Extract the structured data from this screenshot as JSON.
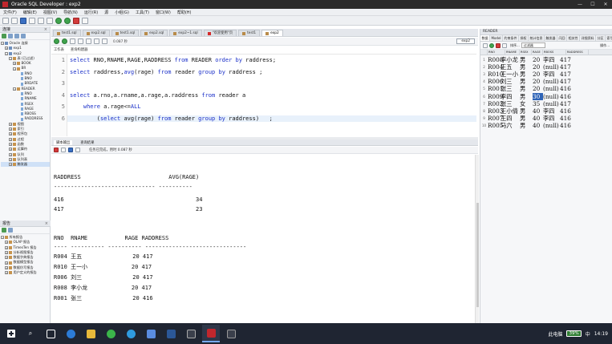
{
  "window": {
    "title": "Oracle SQL Developer : exp2",
    "controls": [
      "—",
      "☐",
      "✕"
    ]
  },
  "menu": [
    "文件(F)",
    "编辑(E)",
    "视图(V)",
    "导航(N)",
    "运行(R)",
    "源",
    "小组(G)",
    "工具(T)",
    "窗口(W)",
    "帮助(H)"
  ],
  "connections_panel": {
    "title": "连接",
    "close": "×",
    "tree": [
      {
        "label": "Oracle 连接",
        "level": 0,
        "toggle": "−",
        "icon": "db"
      },
      {
        "label": "exp1",
        "level": 1,
        "toggle": "+",
        "icon": "db"
      },
      {
        "label": "exp2",
        "level": 1,
        "toggle": "−",
        "icon": "db"
      },
      {
        "label": "表 (已过滤)",
        "level": 2,
        "toggle": "−",
        "icon": "folder"
      },
      {
        "label": "BOOK",
        "level": 3,
        "toggle": "+",
        "icon": "table"
      },
      {
        "label": "BR",
        "level": 3,
        "toggle": "−",
        "icon": "table"
      },
      {
        "label": "RNO",
        "level": 4,
        "toggle": "",
        "icon": "col"
      },
      {
        "label": "BNO",
        "level": 4,
        "toggle": "",
        "icon": "col"
      },
      {
        "label": "BRDATE",
        "level": 4,
        "toggle": "",
        "icon": "col"
      },
      {
        "label": "READER",
        "level": 3,
        "toggle": "−",
        "icon": "table"
      },
      {
        "label": "RNO",
        "level": 4,
        "toggle": "",
        "icon": "col"
      },
      {
        "label": "RNAME",
        "level": 4,
        "toggle": "",
        "icon": "col"
      },
      {
        "label": "RSEX",
        "level": 4,
        "toggle": "",
        "icon": "col"
      },
      {
        "label": "RAGE",
        "level": 4,
        "toggle": "",
        "icon": "col"
      },
      {
        "label": "RBOSS",
        "level": 4,
        "toggle": "",
        "icon": "col"
      },
      {
        "label": "RADDRESS",
        "level": 4,
        "toggle": "",
        "icon": "col"
      },
      {
        "label": "视图",
        "level": 2,
        "toggle": "+",
        "icon": "folder"
      },
      {
        "label": "索引",
        "level": 2,
        "toggle": "+",
        "icon": "folder"
      },
      {
        "label": "程序包",
        "level": 2,
        "toggle": "+",
        "icon": "folder"
      },
      {
        "label": "过程",
        "level": 2,
        "toggle": "+",
        "icon": "folder"
      },
      {
        "label": "函数",
        "level": 2,
        "toggle": "+",
        "icon": "folder"
      },
      {
        "label": "运算符",
        "level": 2,
        "toggle": "+",
        "icon": "folder"
      },
      {
        "label": "队列",
        "level": 2,
        "toggle": "+",
        "icon": "folder"
      },
      {
        "label": "队列表",
        "level": 2,
        "toggle": "+",
        "icon": "folder"
      },
      {
        "label": "触发器",
        "level": 2,
        "toggle": "+",
        "icon": "folder",
        "selected": true
      }
    ]
  },
  "reports_panel": {
    "title": "报告",
    "close": "×",
    "tree": [
      {
        "label": "所有报告",
        "level": 0,
        "toggle": "−"
      },
      {
        "label": "OLAP 报告",
        "level": 1,
        "toggle": "+"
      },
      {
        "label": "TimesTen 报告",
        "level": 1,
        "toggle": "+"
      },
      {
        "label": "分析视图报告",
        "level": 1,
        "toggle": "+"
      },
      {
        "label": "数据字典报告",
        "level": 1,
        "toggle": "+"
      },
      {
        "label": "数据模型报告",
        "level": 1,
        "toggle": "+"
      },
      {
        "label": "数据仿写报告",
        "level": 1,
        "toggle": "+"
      },
      {
        "label": "用户定义的报告",
        "level": 1,
        "toggle": "+"
      }
    ]
  },
  "editor_tabs": [
    {
      "label": "test1.sql",
      "alert": false,
      "active": false
    },
    {
      "label": "exp2.sql",
      "alert": false,
      "active": false
    },
    {
      "label": "test1.sql",
      "alert": false,
      "active": false
    },
    {
      "label": "exp2.sql",
      "alert": false,
      "active": false
    },
    {
      "label": "exp2~1.sql",
      "alert": false,
      "active": false
    },
    {
      "label": "\"欢迎使用\"页",
      "alert": true,
      "active": false
    },
    {
      "label": "test1",
      "alert": false,
      "active": false
    },
    {
      "label": "exp2",
      "alert": false,
      "active": true
    }
  ],
  "editor_toolbar": {
    "time": "0.087 秒",
    "connection": "exp2"
  },
  "editor_subtabs": [
    "工作表",
    "查询构建器"
  ],
  "code_lines": [
    {
      "n": "1",
      "html": "<span class='kw'>select</span> RNO,RNAME,RAGE,RADDRESS <span class='kw'>from</span> READER <span class='kw'>order by</span> raddress;"
    },
    {
      "n": "2",
      "html": "<span class='kw'>select</span> raddress,<span class='kw'>avg</span>(rage) <span class='kw'>from</span> reader <span class='kw'>group by</span> raddress ;"
    },
    {
      "n": "3",
      "html": ""
    },
    {
      "n": "4",
      "html": "<span class='kw'>select</span> a.rno,a.rname,a.rage,a.raddress <span class='kw'>from</span> reader a"
    },
    {
      "n": "5",
      "html": "    <span class='kw'>where</span> a.rage&lt;=<span class='kw'>ALL</span>"
    },
    {
      "n": "6",
      "html": "        (<span class='kw'>select</span> avg(rage) <span class='kw'>from</span> reader <span class='kw'>group by</span> raddress)   ;"
    }
  ],
  "output_tabs": [
    "脚本输出",
    "查询结果"
  ],
  "output_status": "任务已完成，用时 0.087 秒",
  "output_lines": [
    "RADDRESS                          AVG(RAGE)",
    "------------------------------ ----------",
    "416                                       34",
    "417                                       23",
    "",
    "",
    "RNO  RNAME           RAGE RADDRESS",
    "---- ---------- ---------- ------------------------------",
    "R004 王五               20 417",
    "R010 王一小             20 417",
    "R006 刘三               20 417",
    "R008 李小龙             20 417",
    "R001 张三               20 416"
  ],
  "reader_panel": {
    "title": "READER",
    "tabs": [
      "数据",
      "Model",
      "约束条件",
      "授权",
      "统计信息",
      "触发器",
      "闪回",
      "相关性",
      "详细资料",
      "分区",
      "索引",
      "SQL"
    ],
    "filter_label": "过滤器",
    "sort_label": "排序...",
    "actions_label": "操作...",
    "columns": [
      "RNO",
      "RNAME",
      "RSEX",
      "RAGE",
      "RBOSS",
      "RADDRESS"
    ],
    "rows": [
      [
        "1",
        "R008",
        "李小龙",
        "男",
        "20",
        "李四",
        "417"
      ],
      [
        "2",
        "R004",
        "王五",
        "男",
        "20",
        "(null)",
        "417"
      ],
      [
        "3",
        "R010",
        "王一小",
        "男",
        "20",
        "李四",
        "417"
      ],
      [
        "4",
        "R006",
        "刘三",
        "男",
        "20",
        "(null)",
        "417"
      ],
      [
        "5",
        "R001",
        "张三",
        "男",
        "20",
        "(null)",
        "416"
      ],
      [
        "6",
        "R009",
        "李四",
        "男",
        "30",
        "(null)",
        "416"
      ],
      [
        "7",
        "R002",
        "张三",
        "女",
        "35",
        "(null)",
        "417"
      ],
      [
        "8",
        "R003",
        "王小倩",
        "男",
        "40",
        "李四",
        "416"
      ],
      [
        "9",
        "R007",
        "王四",
        "男",
        "40",
        "李四",
        "416"
      ],
      [
        "10",
        "R005",
        "马六",
        "男",
        "40",
        "(null)",
        "416"
      ]
    ],
    "selected_cell": {
      "row": 5,
      "col": 4
    }
  },
  "taskbar": {
    "tray_text": "此电脑",
    "battery": "39%",
    "ime": "中",
    "clock": "14:19"
  },
  "colors": {
    "keyword": "#1b30c9",
    "titlebar": "#2b2b2b",
    "taskbar": "#1f2532",
    "selection": "#2f64b7"
  }
}
